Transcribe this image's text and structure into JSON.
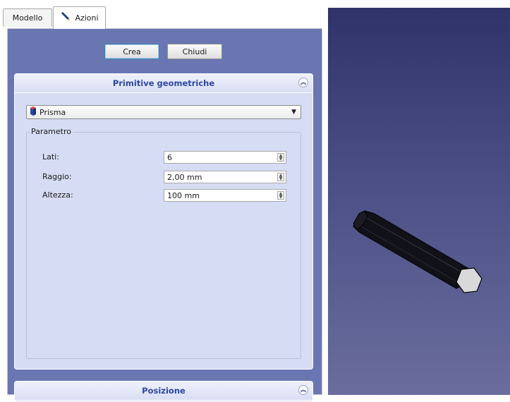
{
  "tabs": [
    {
      "label": "Modello",
      "active": false
    },
    {
      "label": "Azioni",
      "active": true,
      "icon": "pencil-icon"
    }
  ],
  "actions": {
    "create_label": "Crea",
    "close_label": "Chiudi"
  },
  "primitive_group": {
    "title": "Primitive geometriche",
    "collapse_icon": "double-chevron-up-icon",
    "selected_primitive": "Prisma",
    "primitive_icon": "prism-icon",
    "parameter_title": "Parametro",
    "params": [
      {
        "label": "Lati:",
        "value": "6"
      },
      {
        "label": "Raggio:",
        "value": "2,00 mm"
      },
      {
        "label": "Altezza:",
        "value": "100 mm"
      }
    ]
  },
  "position_group": {
    "title": "Posizione",
    "collapse_icon": "double-chevron-up-icon"
  },
  "colors": {
    "panel_background": "#6976b2",
    "group_background": "#d6dcf3",
    "group_title": "#2b47a2",
    "viewport_top": "#30336a",
    "viewport_bottom": "#6a6d9d"
  }
}
